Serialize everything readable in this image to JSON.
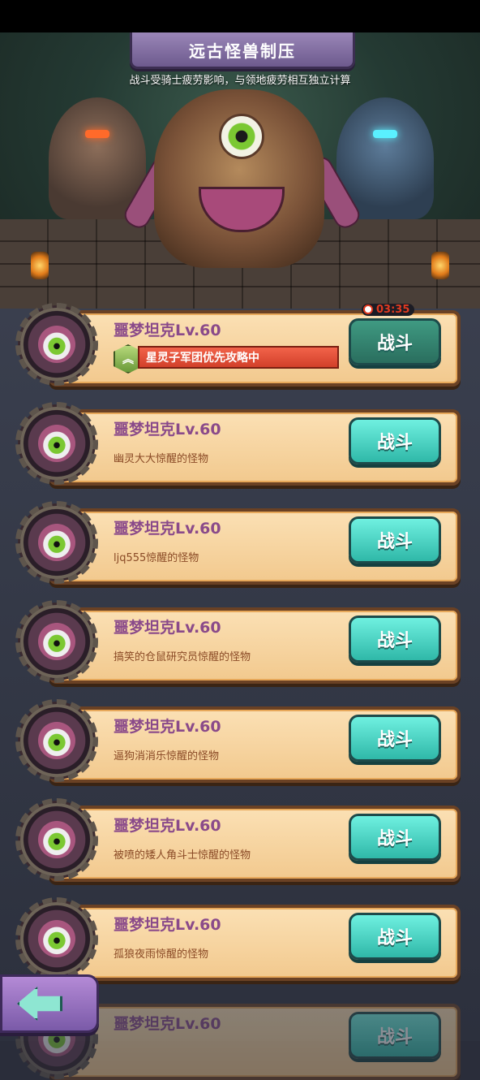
{
  "header": {
    "title": "远古怪兽制压",
    "subtitle": "战斗受骑士疲劳影响，与领地疲劳相互独立计算"
  },
  "featured": {
    "timer": "03:35",
    "banner_text": "星灵子军团优先攻略中"
  },
  "fight_label": "战斗",
  "monsters": [
    {
      "name": "噩梦坦克Lv.60",
      "desc": ""
    },
    {
      "name": "噩梦坦克Lv.60",
      "desc": "幽灵大大惊醒的怪物"
    },
    {
      "name": "噩梦坦克Lv.60",
      "desc": "ljq555惊醒的怪物"
    },
    {
      "name": "噩梦坦克Lv.60",
      "desc": "搞笑的仓鼠研究员惊醒的怪物"
    },
    {
      "name": "噩梦坦克Lv.60",
      "desc": "逼狗消消乐惊醒的怪物"
    },
    {
      "name": "噩梦坦克Lv.60",
      "desc": "被喷的矮人角斗士惊醒的怪物"
    },
    {
      "name": "噩梦坦克Lv.60",
      "desc": "孤狼夜雨惊醒的怪物"
    },
    {
      "name": "噩梦坦克Lv.60",
      "desc": ""
    }
  ],
  "icons": {
    "back": "back-arrow-icon",
    "timer": "clock-icon",
    "badge": "rank-chevron-icon"
  }
}
